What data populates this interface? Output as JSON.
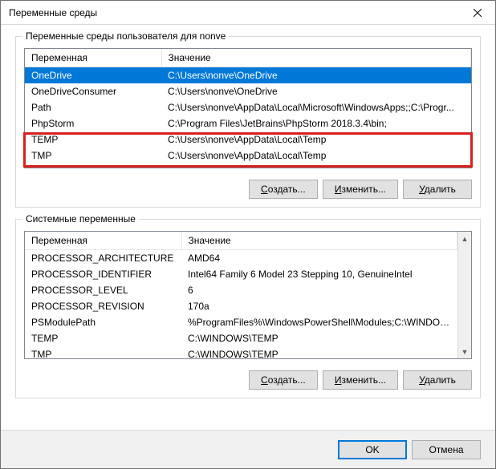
{
  "window": {
    "title": "Переменные среды"
  },
  "userGroup": {
    "label": "Переменные среды пользователя для nonve",
    "headers": {
      "var": "Переменная",
      "val": "Значение"
    },
    "rows": [
      {
        "var": "OneDrive",
        "val": "C:\\Users\\nonve\\OneDrive",
        "selected": true
      },
      {
        "var": "OneDriveConsumer",
        "val": "C:\\Users\\nonve\\OneDrive"
      },
      {
        "var": "Path",
        "val": "C:\\Users\\nonve\\AppData\\Local\\Microsoft\\WindowsApps;;C:\\Progr..."
      },
      {
        "var": "PhpStorm",
        "val": "C:\\Program Files\\JetBrains\\PhpStorm 2018.3.4\\bin;"
      },
      {
        "var": "TEMP",
        "val": "C:\\Users\\nonve\\AppData\\Local\\Temp"
      },
      {
        "var": "TMP",
        "val": "C:\\Users\\nonve\\AppData\\Local\\Temp"
      }
    ],
    "buttons": {
      "new": "Создать...",
      "edit": "Изменить...",
      "delete": "Удалить"
    }
  },
  "sysGroup": {
    "label": "Системные переменные",
    "headers": {
      "var": "Переменная",
      "val": "Значение"
    },
    "rows": [
      {
        "var": "PROCESSOR_ARCHITECTURE",
        "val": "AMD64"
      },
      {
        "var": "PROCESSOR_IDENTIFIER",
        "val": "Intel64 Family 6 Model 23 Stepping 10, GenuineIntel"
      },
      {
        "var": "PROCESSOR_LEVEL",
        "val": "6"
      },
      {
        "var": "PROCESSOR_REVISION",
        "val": "170a"
      },
      {
        "var": "PSModulePath",
        "val": "%ProgramFiles%\\WindowsPowerShell\\Modules;C:\\WINDOWS\\syst..."
      },
      {
        "var": "TEMP",
        "val": "C:\\WINDOWS\\TEMP"
      },
      {
        "var": "TMP",
        "val": "C:\\WINDOWS\\TEMP"
      }
    ],
    "buttons": {
      "new": "Создать...",
      "edit": "Изменить...",
      "delete": "Удалить"
    }
  },
  "footer": {
    "ok": "OK",
    "cancel": "Отмена"
  }
}
